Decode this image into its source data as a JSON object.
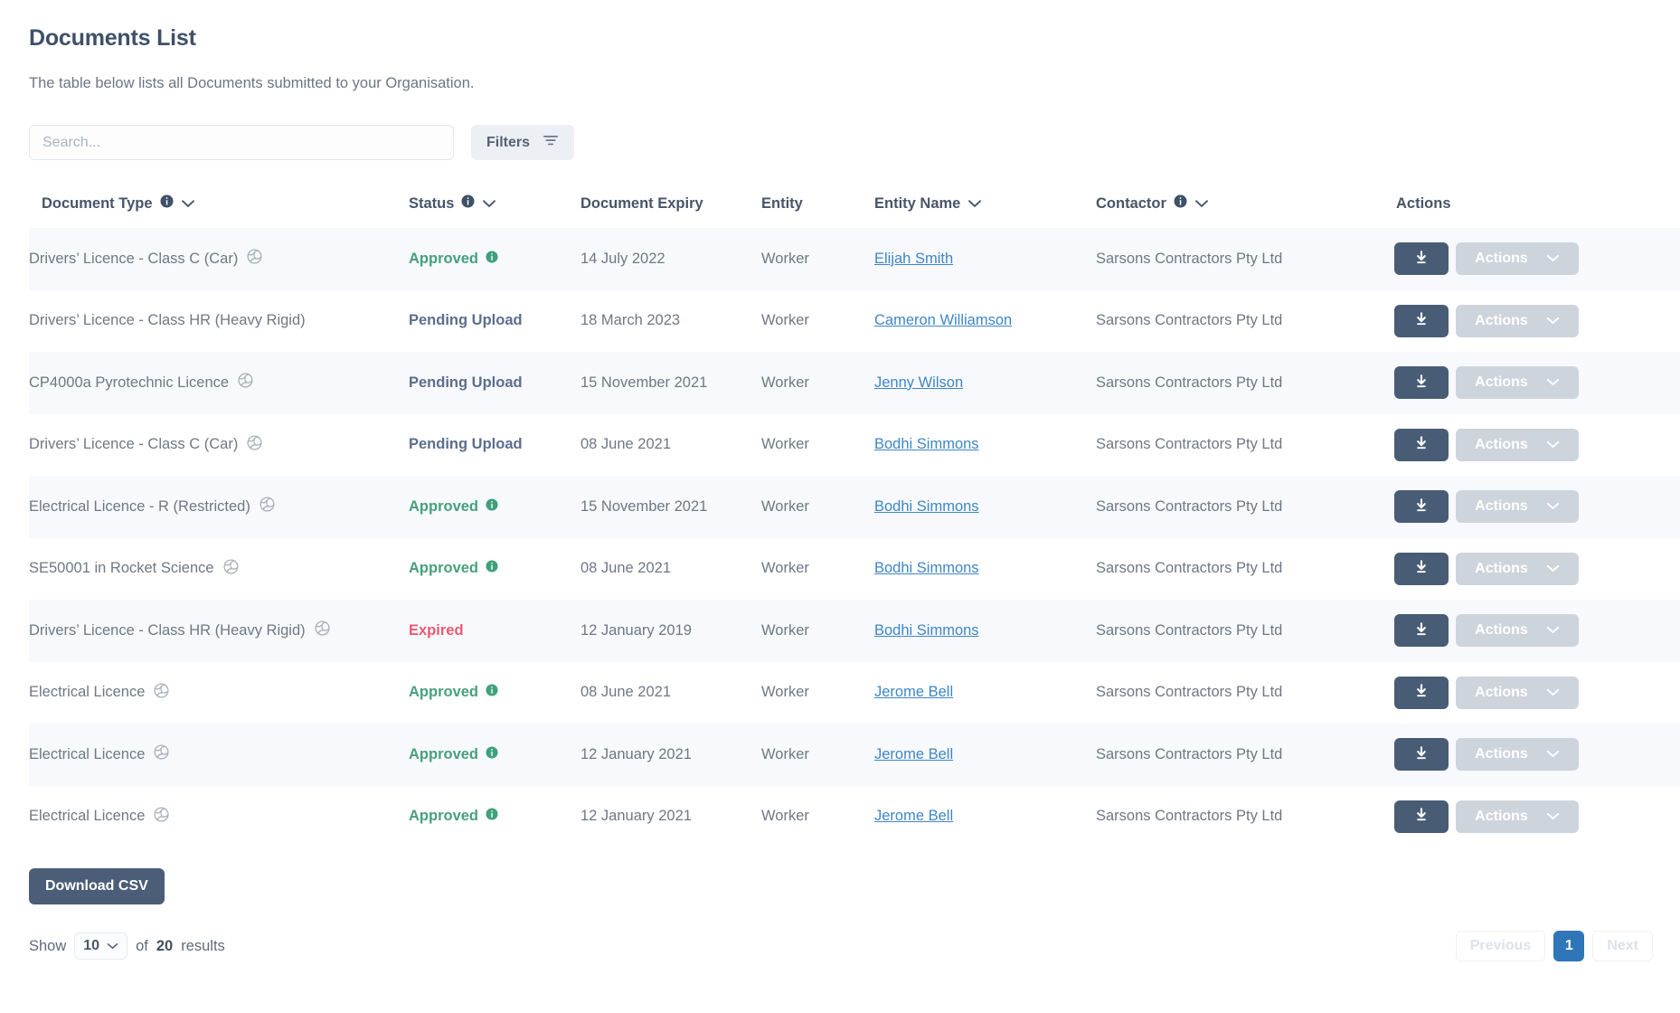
{
  "header": {
    "title": "Documents List",
    "subtitle": "The table below lists all Documents submitted to your Organisation."
  },
  "toolbar": {
    "search_placeholder": "Search...",
    "search_value": "",
    "filters_label": "Filters",
    "filters_icon": "filter-icon"
  },
  "table": {
    "columns": [
      {
        "label": "Document Type",
        "info": true,
        "sort": true
      },
      {
        "label": "Status",
        "info": true,
        "sort": true
      },
      {
        "label": "Document Expiry",
        "info": false,
        "sort": false
      },
      {
        "label": "Entity",
        "info": false,
        "sort": false
      },
      {
        "label": "Entity Name",
        "info": false,
        "sort": true
      },
      {
        "label": "Contactor",
        "info": true,
        "sort": true
      },
      {
        "label": "Actions",
        "info": false,
        "sort": false
      }
    ],
    "row_actions": {
      "download_icon": "download-icon",
      "actions_label": "Actions",
      "actions_chevron": "chevron-down-icon"
    },
    "rows": [
      {
        "document_type": "Drivers’ Licence - Class C (Car)",
        "global_icon": true,
        "status": "Approved",
        "status_kind": "approved",
        "status_info": true,
        "document_expiry": "14 July 2022",
        "entity": "Worker",
        "entity_name": "Elijah Smith",
        "contactor": "Sarsons Contractors Pty Ltd"
      },
      {
        "document_type": "Drivers’ Licence - Class HR (Heavy Rigid)",
        "global_icon": false,
        "status": "Pending Upload",
        "status_kind": "pending",
        "status_info": false,
        "document_expiry": "18 March 2023",
        "entity": "Worker",
        "entity_name": "Cameron Williamson",
        "contactor": "Sarsons Contractors Pty Ltd"
      },
      {
        "document_type": "CP4000a Pyrotechnic Licence",
        "global_icon": true,
        "status": "Pending Upload",
        "status_kind": "pending",
        "status_info": false,
        "document_expiry": "15 November 2021",
        "entity": "Worker",
        "entity_name": "Jenny Wilson",
        "contactor": "Sarsons Contractors Pty Ltd"
      },
      {
        "document_type": "Drivers’ Licence - Class C (Car)",
        "global_icon": true,
        "status": "Pending Upload",
        "status_kind": "pending",
        "status_info": false,
        "document_expiry": "08 June 2021",
        "entity": "Worker",
        "entity_name": "Bodhi Simmons",
        "contactor": "Sarsons Contractors Pty Ltd"
      },
      {
        "document_type": "Electrical Licence - R (Restricted)",
        "global_icon": true,
        "status": "Approved",
        "status_kind": "approved",
        "status_info": true,
        "document_expiry": "15 November 2021",
        "entity": "Worker",
        "entity_name": "Bodhi Simmons",
        "contactor": "Sarsons Contractors Pty Ltd"
      },
      {
        "document_type": "SE50001 in Rocket Science",
        "global_icon": true,
        "status": "Approved",
        "status_kind": "approved",
        "status_info": true,
        "document_expiry": "08 June 2021",
        "entity": "Worker",
        "entity_name": "Bodhi Simmons",
        "contactor": "Sarsons Contractors Pty Ltd"
      },
      {
        "document_type": "Drivers’ Licence - Class HR (Heavy Rigid)",
        "global_icon": true,
        "status": "Expired",
        "status_kind": "expired",
        "status_info": false,
        "document_expiry": "12 January 2019",
        "entity": "Worker",
        "entity_name": "Bodhi Simmons",
        "contactor": "Sarsons Contractors Pty Ltd"
      },
      {
        "document_type": "Electrical Licence",
        "global_icon": true,
        "status": "Approved",
        "status_kind": "approved",
        "status_info": true,
        "document_expiry": "08 June 2021",
        "entity": "Worker",
        "entity_name": "Jerome Bell",
        "contactor": "Sarsons Contractors Pty Ltd"
      },
      {
        "document_type": "Electrical Licence",
        "global_icon": true,
        "status": "Approved",
        "status_kind": "approved",
        "status_info": true,
        "document_expiry": "12 January 2021",
        "entity": "Worker",
        "entity_name": "Jerome Bell",
        "contactor": "Sarsons Contractors Pty Ltd"
      },
      {
        "document_type": "Electrical Licence",
        "global_icon": true,
        "status": "Approved",
        "status_kind": "approved",
        "status_info": true,
        "document_expiry": "12 January 2021",
        "entity": "Worker",
        "entity_name": "Jerome Bell",
        "contactor": "Sarsons Contractors Pty Ltd"
      }
    ]
  },
  "footer": {
    "download_csv_label": "Download CSV",
    "show_label": "Show",
    "page_size": "10",
    "of_label": "of",
    "total_results": "20",
    "results_label": "results",
    "pagination": {
      "previous_label": "Previous",
      "next_label": "Next",
      "pages": [
        "1"
      ],
      "current_page": "1"
    }
  },
  "colors": {
    "title": "#3f5068",
    "approved": "#47a07d",
    "pending": "#5b6e8d",
    "expired": "#ea5a70",
    "link": "#3f86c7",
    "dark_button": "#495c76",
    "active_page": "#2f76b8",
    "row_alt": "#f7f9fc"
  }
}
